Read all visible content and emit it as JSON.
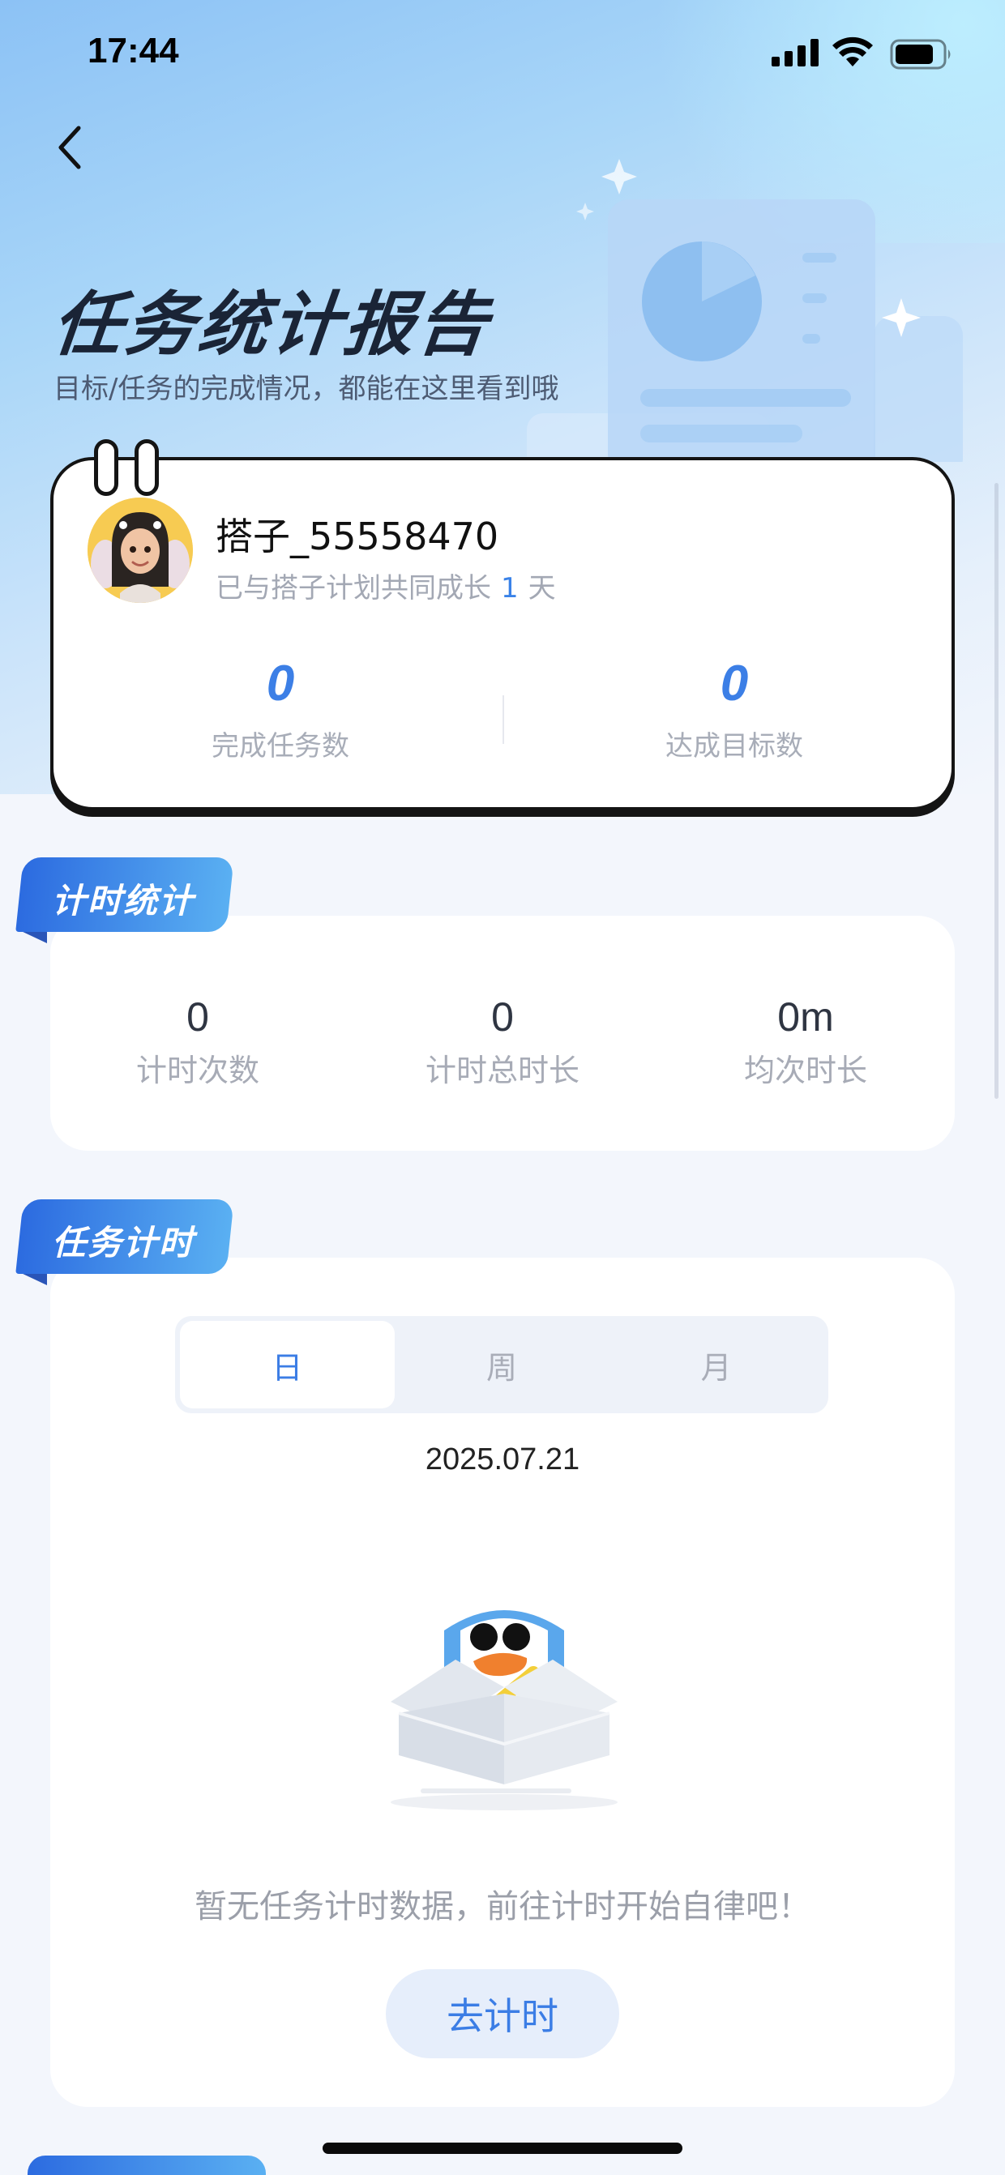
{
  "status_bar": {
    "time": "17:44"
  },
  "header": {
    "title": "任务统计报告",
    "subtitle": "目标/任务的完成情况，都能在这里看到哦"
  },
  "profile": {
    "username": "搭子_55558470",
    "growth_prefix": "已与搭子计划共同成长",
    "growth_days": "1",
    "growth_suffix": "天",
    "stats": [
      {
        "value": "0",
        "label": "完成任务数"
      },
      {
        "value": "0",
        "label": "达成目标数"
      }
    ]
  },
  "timing_stats": {
    "section_title": "计时统计",
    "items": [
      {
        "value": "0",
        "label": "计时次数"
      },
      {
        "value": "0",
        "label": "计时总时长"
      },
      {
        "value": "0m",
        "label": "均次时长"
      }
    ]
  },
  "task_timing": {
    "section_title": "任务计时",
    "tabs": [
      {
        "label": "日",
        "active": true
      },
      {
        "label": "周",
        "active": false
      },
      {
        "label": "月",
        "active": false
      }
    ],
    "date": "2025.07.21",
    "empty_text": "暂无任务计时数据，前往计时开始自律吧！",
    "button_label": "去计时"
  },
  "colors": {
    "accent": "#3b7de5",
    "title": "#1a2436",
    "muted": "#a8adb8"
  }
}
